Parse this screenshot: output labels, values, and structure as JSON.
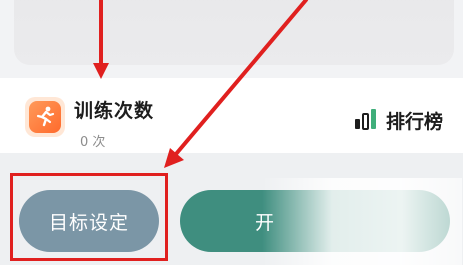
{
  "training": {
    "title": "训练次数",
    "count": "0 次"
  },
  "leaderboard": {
    "label": "排行榜",
    "icon": "bar-chart-icon"
  },
  "buttons": {
    "goal_label": "目标设定",
    "start_label": "开"
  },
  "annotations": {
    "color": "#e0201f"
  },
  "colors": {
    "goal_button": "#7b96a6",
    "start_button": "#3f8e7f",
    "icon_orange": "#ff7a3a"
  }
}
